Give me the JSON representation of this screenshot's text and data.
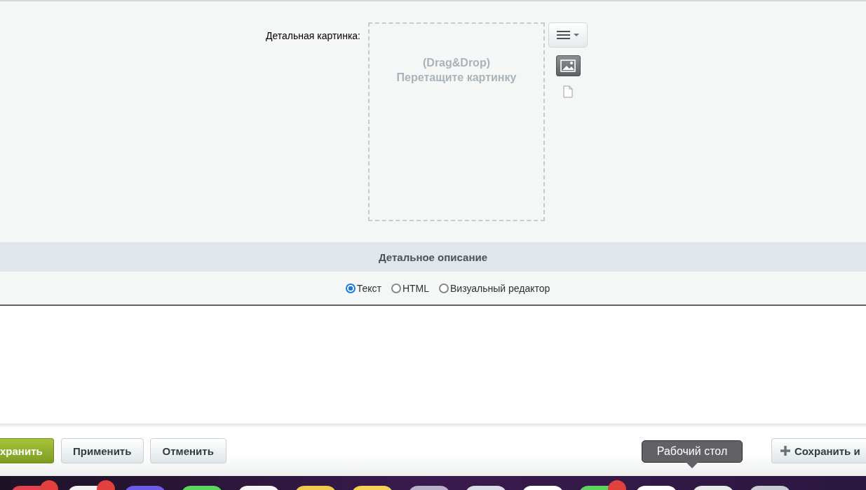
{
  "image_field": {
    "label": "Детальная картинка:",
    "dropzone_lines": [
      "(Drag&Drop)",
      "Перетащите картинку"
    ],
    "sources": [
      {
        "kind": "image",
        "selected": true
      },
      {
        "kind": "file",
        "selected": false
      }
    ]
  },
  "section": {
    "title": "Детальное описание"
  },
  "editor_modes": [
    {
      "label": "Текст",
      "selected": true
    },
    {
      "label": "HTML",
      "selected": false
    },
    {
      "label": "Визуальный редактор",
      "selected": false
    }
  ],
  "buttons": [
    {
      "label": "хранить",
      "kind": "primary"
    },
    {
      "label": "Применить",
      "kind": "normal"
    },
    {
      "label": "Отменить",
      "kind": "normal"
    },
    {
      "label": "Сохранить и",
      "kind": "add"
    }
  ],
  "tooltip": {
    "text": "Рабочий стол"
  },
  "dock": {
    "items": [
      {
        "color": "#e0444e",
        "badge": true
      },
      {
        "color": "#f2f2f2",
        "badge": true
      },
      {
        "color": "#6c5ce7",
        "badge": false
      },
      {
        "color": "#5fd35f",
        "badge": false
      },
      {
        "color": "#f5f5f5",
        "badge": false
      },
      {
        "color": "#f2c94c",
        "badge": false
      },
      {
        "color": "#f7d154",
        "badge": false
      },
      {
        "color": "#b8b0c8",
        "badge": false
      },
      {
        "color": "#d8dde6",
        "badge": false
      },
      {
        "color": "#ffffff",
        "badge": false
      },
      {
        "color": "#5fd35f",
        "badge": true
      },
      {
        "color": "#ffffff",
        "badge": false
      },
      {
        "color": "#e8ece8",
        "badge": false
      },
      {
        "color": "#c9ccd4",
        "badge": false
      }
    ]
  }
}
